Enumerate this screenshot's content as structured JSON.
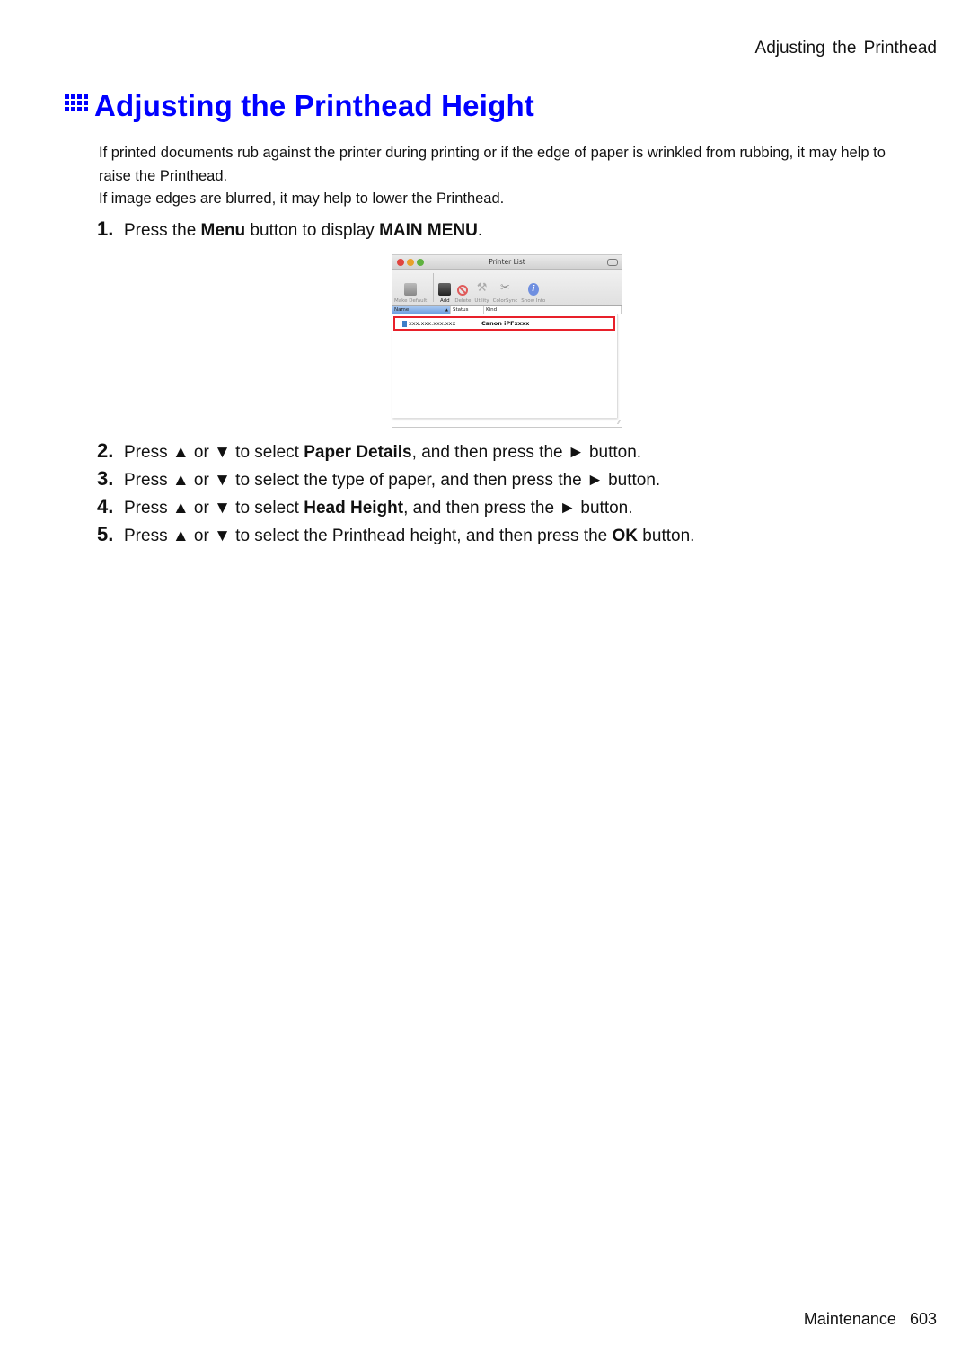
{
  "header": {
    "section": "Adjusting the Printhead"
  },
  "title": {
    "icon": "grid-icon",
    "text": "Adjusting the Printhead Height",
    "color": "#0000ff"
  },
  "intro": [
    "If printed documents rub against the printer during printing or if the edge of paper is wrinkled from rubbing, it may help to raise the Printhead.",
    "If image edges are blurred, it may help to lower the Printhead."
  ],
  "steps": [
    {
      "num": "1.",
      "parts": [
        "Press the ",
        "Menu",
        " button to display ",
        "MAIN MENU",
        "."
      ]
    },
    {
      "num": "2.",
      "parts": [
        "Press ▲ or ▼ to select ",
        "Paper Details",
        ", and then press the ► button."
      ]
    },
    {
      "num": "3.",
      "parts": [
        "Press ▲ or ▼ to select the type of paper, and then press the ► button."
      ]
    },
    {
      "num": "4.",
      "parts": [
        "Press ▲ or ▼ to select ",
        "Head Height",
        ", and then press the ► button."
      ]
    },
    {
      "num": "5.",
      "parts": [
        "Press ▲ or ▼ to select the Printhead height, and then press the ",
        "OK",
        " button."
      ]
    }
  ],
  "printer_list": {
    "title": "Printer List",
    "toolbar": [
      {
        "label": "Make Default",
        "icon": "printer-icon"
      },
      {
        "label": "Add",
        "icon": "add-printer-icon"
      },
      {
        "label": "Delete",
        "icon": "delete-icon"
      },
      {
        "label": "Utility",
        "icon": "utility-icon"
      },
      {
        "label": "ColorSync",
        "icon": "colorsync-icon"
      },
      {
        "label": "Show Info",
        "icon": "info-icon"
      }
    ],
    "columns": [
      "Name",
      "Status",
      "Kind"
    ],
    "rows": [
      {
        "name": "xxx.xxx.xxx.xxx",
        "status": "",
        "kind": "Canon iPFxxxx"
      }
    ],
    "highlight_color": "#e8202a"
  },
  "footer": {
    "chapter": "Maintenance",
    "page": "603"
  }
}
